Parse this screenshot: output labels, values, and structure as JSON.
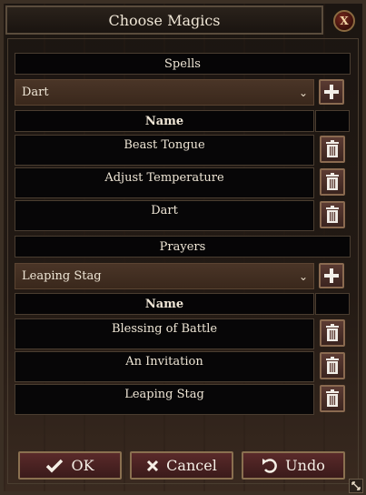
{
  "window": {
    "title": "Choose Magics"
  },
  "spells": {
    "header": "Spells",
    "selected": "Dart",
    "column_name": "Name",
    "items": [
      "Beast Tongue",
      "Adjust Temperature",
      "Dart"
    ]
  },
  "prayers": {
    "header": "Prayers",
    "selected": "Leaping Stag",
    "column_name": "Name",
    "items": [
      "Blessing of Battle",
      "An Invitation",
      "Leaping Stag"
    ]
  },
  "footer": {
    "ok_label": "OK",
    "cancel_label": "Cancel",
    "undo_label": "Undo"
  },
  "icons": {
    "close": "close-icon",
    "add": "plus-icon",
    "delete": "trash-icon",
    "ok": "checkmark-icon",
    "cancel": "x-icon",
    "undo": "undo-icon",
    "dropdown": "chevron-down-icon",
    "resize": "resize-icon"
  },
  "colors": {
    "background": "#120d0a",
    "panel": "#070607",
    "border": "#4a3d30",
    "button": "#5a2a2a",
    "text": "#efe6d6"
  }
}
